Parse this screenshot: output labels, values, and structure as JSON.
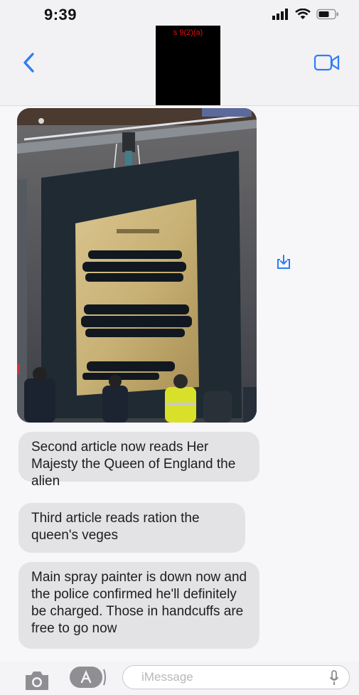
{
  "status": {
    "time": "9:39"
  },
  "header": {
    "redaction_label": "s 9(2)(a)"
  },
  "messages": [
    {
      "text": "Second article now reads Her Majesty the Queen of England the alien"
    },
    {
      "text": "Third article reads ration the queen's veges"
    },
    {
      "text": "Main spray painter is down now and the police confirmed he'll definitely be charged. Those in handcuffs are free to go now"
    }
  ],
  "compose": {
    "placeholder": "iMessage"
  },
  "icons": {
    "back": "chevron-left-icon",
    "video": "video-camera-icon",
    "save": "share-download-icon",
    "camera": "camera-icon",
    "appstore": "app-store-icon",
    "mic": "microphone-icon",
    "signal": "signal-bars-icon",
    "wifi": "wifi-icon",
    "battery": "battery-icon"
  },
  "colors": {
    "accent": "#2f7cf6",
    "bubble": "#e3e3e6",
    "redaction": "#000000",
    "redaction_text": "#e01010"
  }
}
